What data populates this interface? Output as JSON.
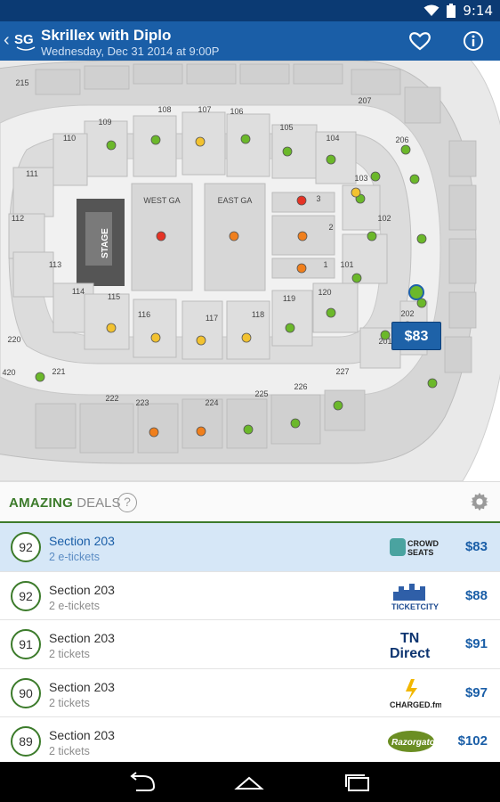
{
  "status_bar": {
    "time": "9:14",
    "icons": [
      "wifi-icon",
      "battery-icon"
    ]
  },
  "app_bar": {
    "title": "Skrillex with Diplo",
    "subtitle": "Wednesday, Dec 31 2014 at 9:00P",
    "logo_text": "SG"
  },
  "map": {
    "stage_label": "STAGE",
    "floor_labels": [
      "WEST GA",
      "EAST GA"
    ],
    "floor_sections": [
      "3",
      "2",
      "1"
    ],
    "section_labels": [
      "215",
      "207",
      "108",
      "107",
      "106",
      "109",
      "105",
      "110",
      "104",
      "206",
      "111",
      "103",
      "112",
      "102",
      "113",
      "101",
      "114",
      "120",
      "115",
      "116",
      "117",
      "118",
      "119",
      "202",
      "201",
      "220",
      "221",
      "227",
      "222",
      "223",
      "224",
      "225",
      "226",
      "420"
    ],
    "selected_price": "$83",
    "colors": {
      "green": "#6bb82a",
      "yellow": "#f2c230",
      "orange": "#f07f1c",
      "red": "#e53325"
    }
  },
  "deals": {
    "title_strong": "AMAZING",
    "title_rest": "DEALS",
    "help_label": "?",
    "rows": [
      {
        "score": "92",
        "section": "Section 203",
        "tickets": "2 e-tickets",
        "vendor": "CROWD SEATS",
        "price": "$83",
        "selected": true
      },
      {
        "score": "92",
        "section": "Section 203",
        "tickets": "2 e-tickets",
        "vendor": "TICKETCITY",
        "price": "$88",
        "selected": false
      },
      {
        "score": "91",
        "section": "Section 203",
        "tickets": "2 tickets",
        "vendor": "TN Direct",
        "price": "$91",
        "selected": false
      },
      {
        "score": "90",
        "section": "Section 203",
        "tickets": "2 tickets",
        "vendor": "CHARGED.fm",
        "price": "$97",
        "selected": false
      },
      {
        "score": "89",
        "section": "Section 203",
        "tickets": "2 tickets",
        "vendor": "Razorgator",
        "price": "$102",
        "selected": false
      }
    ]
  },
  "nav": {
    "icons": [
      "back-icon",
      "home-icon",
      "recents-icon"
    ]
  }
}
